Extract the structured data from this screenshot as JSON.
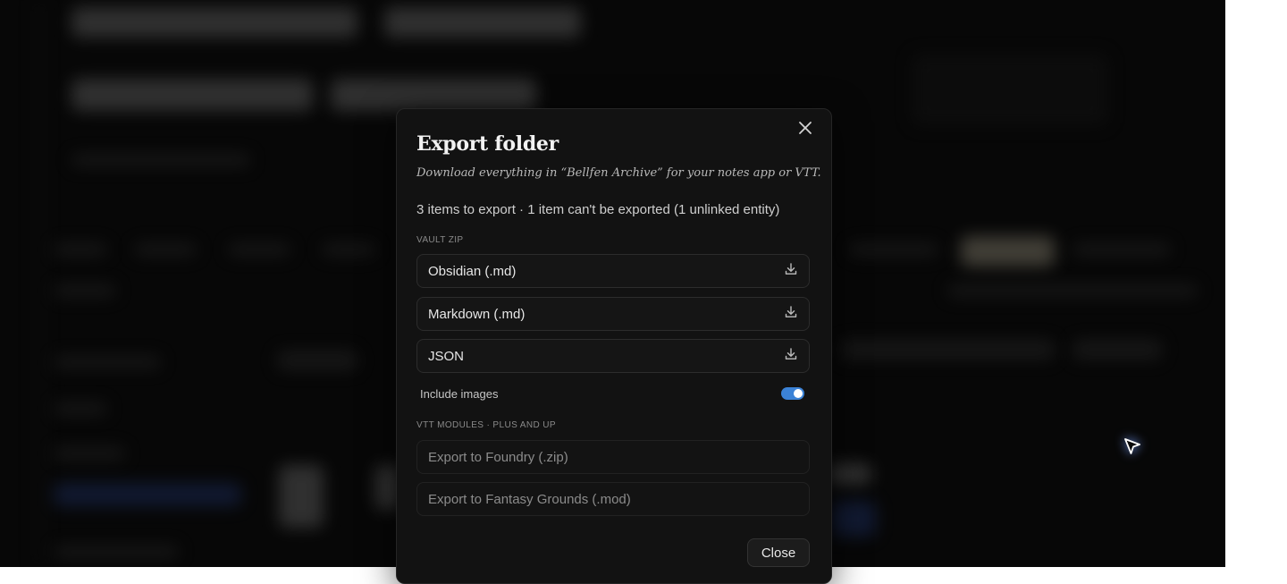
{
  "dialog": {
    "title": "Export folder",
    "subtitle": "Download everything in “Bellfen Archive” for your notes app or VTT.",
    "summary": "3 items to export · 1 item can't be exported (1 unlinked entity)",
    "vault_section_label": "VAULT ZIP",
    "vault_options": [
      {
        "label": "Obsidian (.md)",
        "icon": "download-icon"
      },
      {
        "label": "Markdown (.md)",
        "icon": "download-icon"
      },
      {
        "label": "JSON",
        "icon": "download-icon"
      }
    ],
    "include_images": {
      "label": "Include images",
      "enabled": true
    },
    "vtt_section_label": "VTT MODULES · PLUS AND UP",
    "vtt_options": [
      {
        "label": "Export to Foundry (.zip)",
        "disabled": true
      },
      {
        "label": "Export to Fantasy Grounds (.mod)",
        "disabled": true
      }
    ],
    "close_button": "Close",
    "close_icon": "close-icon"
  },
  "colors": {
    "accent": "#3b82d6",
    "modal_bg": "#121212",
    "backdrop": "#0b0b0b"
  }
}
